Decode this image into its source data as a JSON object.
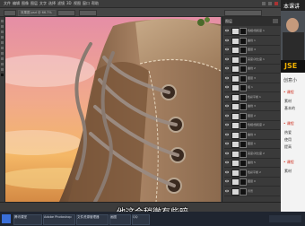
{
  "menubar": {
    "items": [
      "文件",
      "编辑",
      "图像",
      "图层",
      "文字",
      "选择",
      "滤镜",
      "3D",
      "视图",
      "窗口",
      "帮助"
    ]
  },
  "document": {
    "tab_label": "效果图.psd @ 66.7%"
  },
  "layers_panel": {
    "title": "图层",
    "layers": [
      {
        "name": "色相/饱和度 1"
      },
      {
        "name": "曲线 1"
      },
      {
        "name": "图层 4"
      },
      {
        "name": "亮度/对比度 1"
      },
      {
        "name": "曲线 2"
      },
      {
        "name": "图层 3"
      },
      {
        "name": "组 1"
      },
      {
        "name": "色彩平衡 1"
      },
      {
        "name": "曲线 3"
      },
      {
        "name": "图层 2"
      },
      {
        "name": "色相/饱和度 2"
      },
      {
        "name": "曲线 4"
      },
      {
        "name": "图层 1"
      },
      {
        "name": "亮度/对比度 2"
      },
      {
        "name": "曲线 5"
      },
      {
        "name": "色彩平衡 2"
      },
      {
        "name": "图层 0"
      },
      {
        "name": "背景"
      }
    ]
  },
  "webcam_panel": {
    "header": "本课讲",
    "brand": "JSE",
    "lines": [
      "创意小",
      "• 课程",
      "素材",
      "基本的",
      "• 课程",
      "热爱",
      "使用",
      "提高",
      "• 课程",
      "素材"
    ]
  },
  "taskbar": {
    "tasks": [
      "腾讯课堂",
      "Adobe Photoshop",
      "文件资源管理器",
      "画图",
      "QQ"
    ]
  },
  "subtitle": "他这会稍微有些暗",
  "colors": {
    "accent": "#f2b200",
    "subtitle": "#ffffff"
  }
}
